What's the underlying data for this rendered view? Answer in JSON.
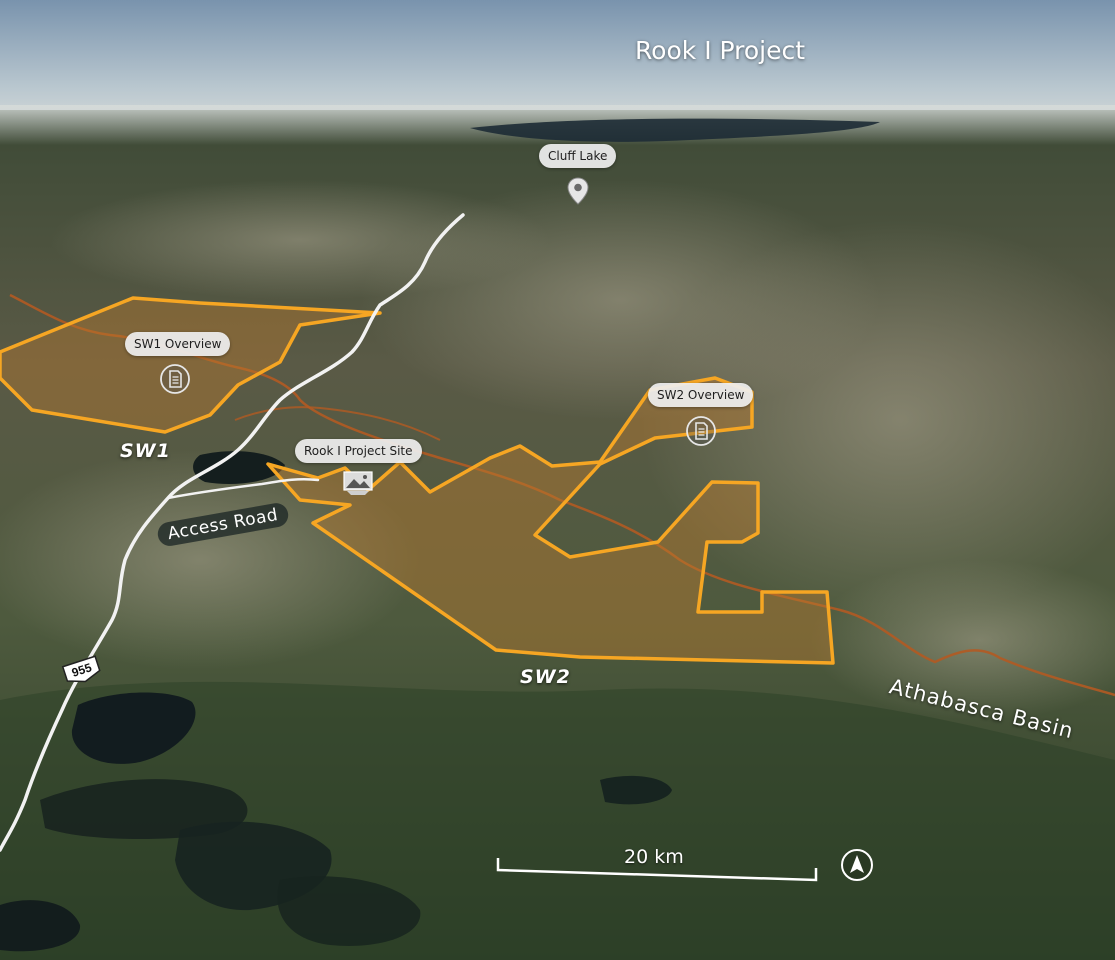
{
  "title": "Rook I Project",
  "markers": {
    "cluff_lake": {
      "label": "Cluff Lake",
      "icon": "location-pin-icon"
    },
    "sw1_overview": {
      "label": "SW1 Overview",
      "icon": "document-icon"
    },
    "sw2_overview": {
      "label": "SW2 Overview",
      "icon": "document-icon"
    },
    "project_site": {
      "label": "Rook I Project Site",
      "icon": "image-icon"
    }
  },
  "zones": {
    "sw1": "SW1",
    "sw2": "SW2"
  },
  "roads": {
    "access_road": "Access Road",
    "highway_number": "955"
  },
  "regions": {
    "basin": "Athabasca Basin"
  },
  "scale_bar": {
    "label": "20 km"
  },
  "compass": {
    "icon": "north-arrow-icon"
  },
  "colors": {
    "zone_outline": "#f6a623",
    "zone_fill": "#b97a2e",
    "road": "#f2f2f2",
    "trail": "#b35a22",
    "sky_top": "#7f9bb5",
    "sky_horizon": "#c9d2d6"
  }
}
